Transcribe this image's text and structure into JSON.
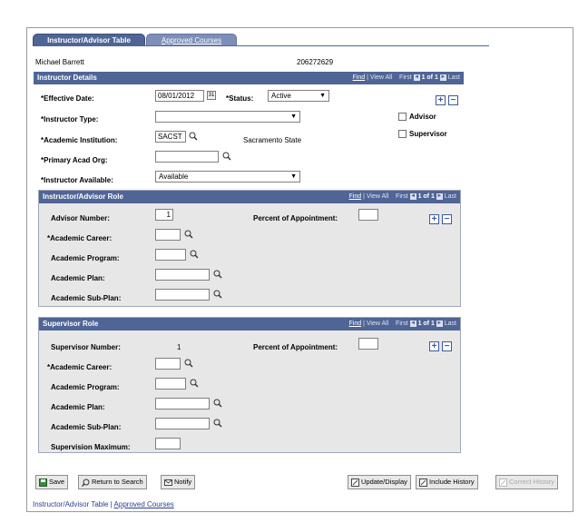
{
  "tabs": {
    "active": "Instructor/Advisor Table",
    "inactive": "Approved Courses"
  },
  "header": {
    "name": "Michael Barrett",
    "id": "206272629"
  },
  "nav": {
    "find": "Find",
    "view_all": "View All",
    "first": "First",
    "count": "1 of 1",
    "last": "Last"
  },
  "instructor_details": {
    "title": "Instructor Details",
    "effective_date_label": "*Effective Date:",
    "effective_date": "08/01/2012",
    "calendar_glyph": "31",
    "status_label": "*Status:",
    "status": "Active",
    "instructor_type_label": "*Instructor Type:",
    "instructor_type": "",
    "advisor_label": "Advisor",
    "supervisor_label": "Supervisor",
    "institution_label": "*Academic Institution:",
    "institution": "SACST",
    "institution_desc": "Sacramento State",
    "acad_org_label": "*Primary Acad Org:",
    "acad_org": "",
    "available_label": "*Instructor Available:",
    "available": "Available"
  },
  "advisor_role": {
    "title": "Instructor/Advisor Role",
    "number_label": "Advisor Number:",
    "number": "1",
    "percent_label": "Percent of Appointment:",
    "career_label": "*Academic Career:",
    "program_label": "Academic Program:",
    "plan_label": "Academic Plan:",
    "subplan_label": "Academic Sub-Plan:"
  },
  "supervisor_role": {
    "title": "Supervisor Role",
    "number_label": "Supervisor Number:",
    "number": "1",
    "percent_label": "Percent of Appointment:",
    "career_label": "*Academic Career:",
    "program_label": "Academic Program:",
    "plan_label": "Academic Plan:",
    "subplan_label": "Academic Sub-Plan:",
    "max_label": "Supervision Maximum:"
  },
  "buttons": {
    "save": "Save",
    "return": "Return to Search",
    "notify": "Notify",
    "update": "Update/Display",
    "history": "Include History",
    "correct": "Correct History"
  },
  "footer": {
    "link1": "Instructor/Advisor Table",
    "sep": " | ",
    "link2": "Approved Courses"
  },
  "symbols": {
    "plus": "+",
    "minus": "−",
    "prev": "◄",
    "next": "►",
    "dropdown": "▼"
  },
  "colors": {
    "header_bar": "#4f6596",
    "panel_bg": "#e7e7e7",
    "link": "#2a3f8f"
  }
}
